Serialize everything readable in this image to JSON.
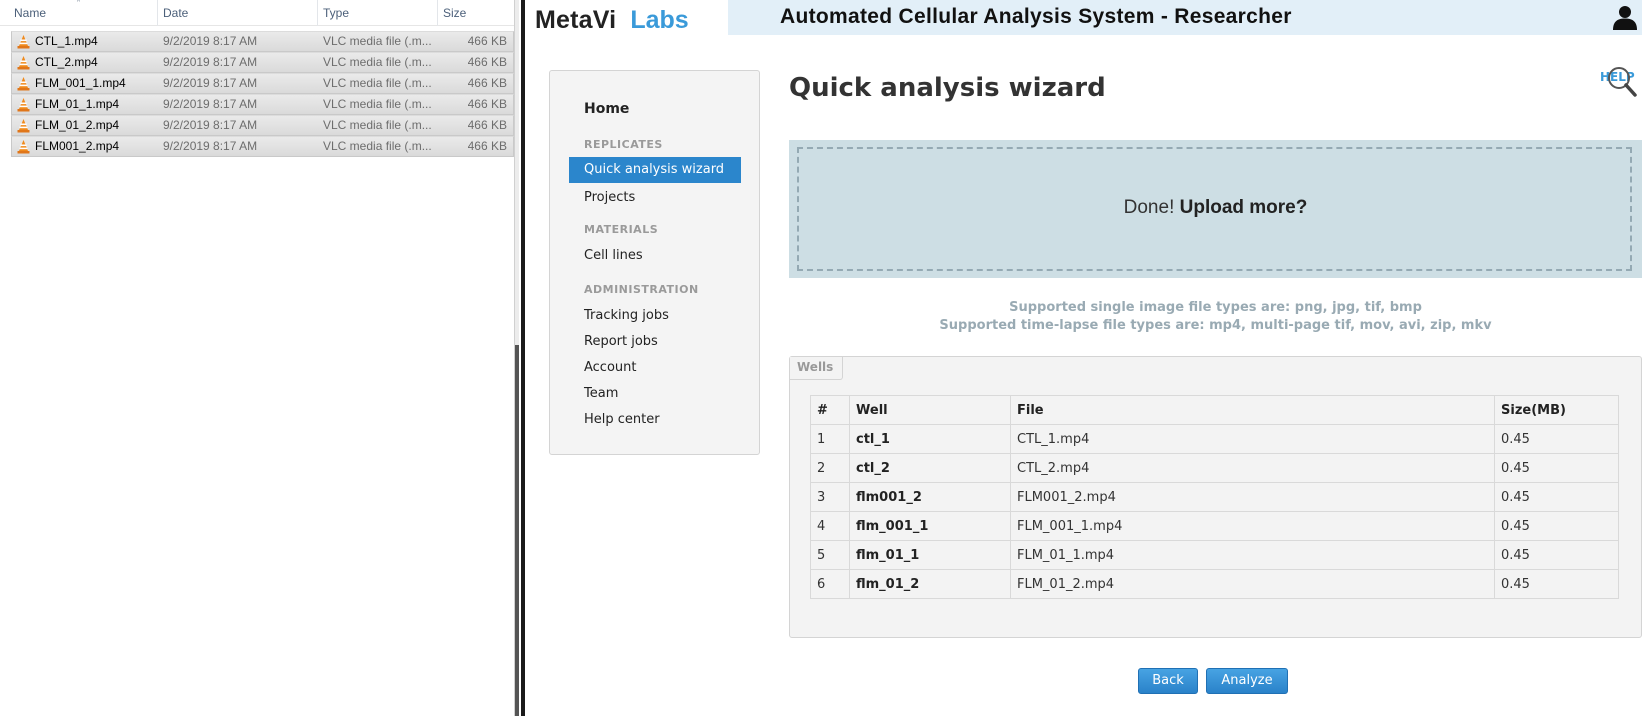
{
  "explorer": {
    "columns": [
      "Name",
      "Date",
      "Type",
      "Size"
    ],
    "files": [
      {
        "name": "CTL_1.mp4",
        "date": "9/2/2019 8:17 AM",
        "type": "VLC media file (.m...",
        "size": "466 KB"
      },
      {
        "name": "CTL_2.mp4",
        "date": "9/2/2019 8:17 AM",
        "type": "VLC media file (.m...",
        "size": "466 KB"
      },
      {
        "name": "FLM_001_1.mp4",
        "date": "9/2/2019 8:17 AM",
        "type": "VLC media file (.m...",
        "size": "466 KB"
      },
      {
        "name": "FLM_01_1.mp4",
        "date": "9/2/2019 8:17 AM",
        "type": "VLC media file (.m...",
        "size": "466 KB"
      },
      {
        "name": "FLM_01_2.mp4",
        "date": "9/2/2019 8:17 AM",
        "type": "VLC media file (.m...",
        "size": "466 KB"
      },
      {
        "name": "FLM001_2.mp4",
        "date": "9/2/2019 8:17 AM",
        "type": "VLC media file (.m...",
        "size": "466 KB"
      }
    ],
    "file_icon": "vlc-cone-icon"
  },
  "header": {
    "logo_part1": "MetaVi",
    "logo_part2": "Labs",
    "title": "Automated Cellular Analysis System - Researcher",
    "user_icon": "user-icon"
  },
  "sidebar": {
    "home": "Home",
    "sections": [
      {
        "title": "REPLICATES",
        "items": [
          "Quick analysis wizard",
          "Projects"
        ]
      },
      {
        "title": "MATERIALS",
        "items": [
          "Cell lines"
        ]
      },
      {
        "title": "ADMINISTRATION",
        "items": [
          "Tracking jobs",
          "Report jobs",
          "Account",
          "Team",
          "Help center"
        ]
      }
    ],
    "active_item": "Quick analysis wizard"
  },
  "main": {
    "page_title": "Quick analysis wizard",
    "help": "HELP",
    "dropzone": {
      "done": "Done!",
      "upload_more": "Upload more?"
    },
    "supported_single": "Supported single image file types are: png, jpg, tif, bmp",
    "supported_timelapse": "Supported time-lapse file types are: mp4, multi-page tif, mov, avi, zip, mkv",
    "wells": {
      "tab_label": "Wells",
      "columns": [
        "#",
        "Well",
        "File",
        "Size(MB)"
      ],
      "rows": [
        {
          "num": "1",
          "well": "ctl_1",
          "file": "CTL_1.mp4",
          "size": "0.45"
        },
        {
          "num": "2",
          "well": "ctl_2",
          "file": "CTL_2.mp4",
          "size": "0.45"
        },
        {
          "num": "3",
          "well": "flm001_2",
          "file": "FLM001_2.mp4",
          "size": "0.45"
        },
        {
          "num": "4",
          "well": "flm_001_1",
          "file": "FLM_001_1.mp4",
          "size": "0.45"
        },
        {
          "num": "5",
          "well": "flm_01_1",
          "file": "FLM_01_1.mp4",
          "size": "0.45"
        },
        {
          "num": "6",
          "well": "flm_01_2",
          "file": "FLM_01_2.mp4",
          "size": "0.45"
        }
      ]
    },
    "buttons": {
      "back": "Back",
      "analyze": "Analyze"
    }
  },
  "colors": {
    "accent": "#2b86cc",
    "logo_accent": "#3a9ad9",
    "dropzone_bg": "#cddee4",
    "title_strip": "#e2eff8"
  }
}
